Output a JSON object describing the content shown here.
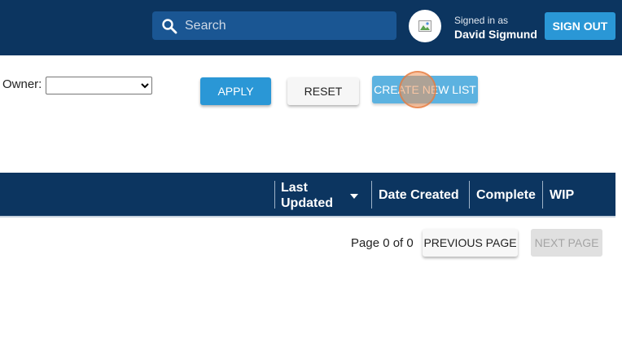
{
  "header": {
    "search_placeholder": "Search",
    "signed_in_label": "Signed in as",
    "user_name": "David Sigmund",
    "sign_out_label": "SIGN OUT"
  },
  "filters": {
    "owner_label": "Owner:",
    "owner_value": "",
    "apply_label": "APPLY",
    "reset_label": "RESET",
    "create_label": "CREATE NEW LIST"
  },
  "table": {
    "columns": [
      {
        "label": "Last Updated",
        "sort": "descending"
      },
      {
        "label": "Date Created"
      },
      {
        "label": "Complete"
      },
      {
        "label": "WIP"
      }
    ],
    "rows": []
  },
  "pagination": {
    "page_info": "Page 0 of 0",
    "prev_label": "PREVIOUS PAGE",
    "next_label": "NEXT PAGE",
    "next_enabled": false
  },
  "colors": {
    "header_bg": "#0c3560",
    "primary_button": "#2a97d6",
    "search_bg": "#1a5693"
  },
  "icons": [
    "search-icon",
    "user-avatar-image",
    "sort-descending-icon"
  ]
}
